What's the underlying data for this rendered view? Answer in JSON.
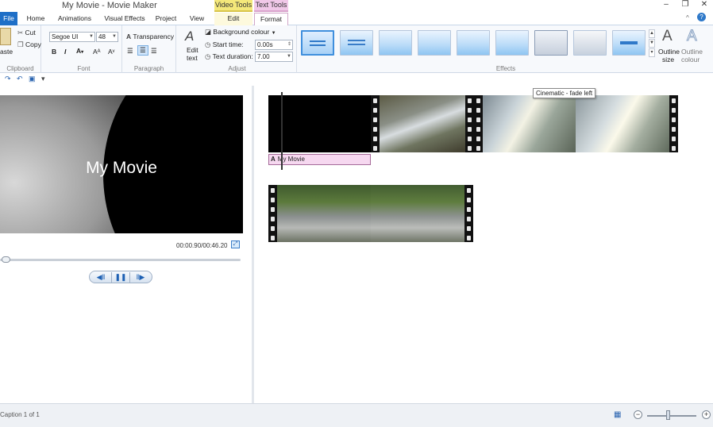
{
  "window": {
    "title": "My Movie - Movie Maker",
    "context_groups": {
      "video_tools": "Video Tools",
      "text_tools": "Text Tools"
    },
    "controls": {
      "minimize": "–",
      "restore": "❐",
      "close": "✕"
    }
  },
  "tabs": {
    "file": "File",
    "home": "Home",
    "animations": "Animations",
    "visual_effects": "Visual Effects",
    "project": "Project",
    "view": "View",
    "edit": "Edit",
    "format": "Format"
  },
  "ribbon": {
    "clipboard": {
      "paste": "aste",
      "cut": "Cut",
      "copy": "Copy",
      "label": "Clipboard"
    },
    "font": {
      "family": "Segoe UI",
      "size": "48",
      "label": "Font"
    },
    "paragraph": {
      "transparency": "Transparency",
      "label": "Paragraph"
    },
    "adjust": {
      "edit_text_1": "Edit",
      "edit_text_2": "text",
      "background_colour": "Background colour",
      "start_time_label": "Start time:",
      "start_time_value": "0.00s",
      "text_duration_label": "Text duration:",
      "text_duration_value": "7.00",
      "label": "Adjust"
    },
    "effects": {
      "label": "Effects",
      "outline_size_1": "Outline",
      "outline_size_2": "size",
      "outline_colour_1": "Outline",
      "outline_colour_2": "colour"
    }
  },
  "tooltip": "Cinematic - fade left",
  "preview": {
    "title_text": "My Movie",
    "timecode": "00:00.90/00:46.20"
  },
  "storyboard": {
    "caption_item": "My Movie"
  },
  "status": {
    "text": "Caption 1 of 1"
  }
}
